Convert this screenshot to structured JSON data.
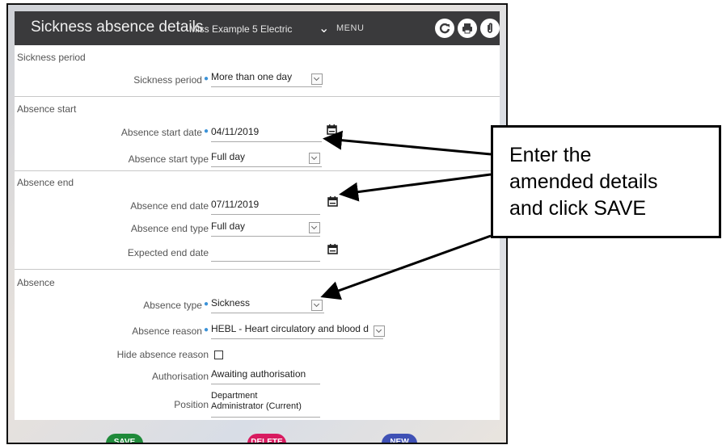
{
  "header": {
    "title": "Sickness absence details",
    "subtitle": "Miss Example 5 Electric",
    "menu_label": "MENU"
  },
  "sections": {
    "sickness_period": {
      "heading": "Sickness period",
      "period_label": "Sickness period",
      "period_value": "More than one day"
    },
    "absence_start": {
      "heading": "Absence start",
      "date_label": "Absence start date",
      "date_value": "04/11/2019",
      "type_label": "Absence start type",
      "type_value": "Full day"
    },
    "absence_end": {
      "heading": "Absence end",
      "date_label": "Absence end date",
      "date_value": "07/11/2019",
      "type_label": "Absence end type",
      "type_value": "Full day",
      "expected_label": "Expected end date",
      "expected_value": ""
    },
    "absence": {
      "heading": "Absence",
      "type_label": "Absence type",
      "type_value": "Sickness",
      "reason_label": "Absence reason",
      "reason_value": "HEBL - Heart circulatory and blood d",
      "hide_label": "Hide absence reason",
      "auth_label": "Authorisation",
      "auth_value": "Awaiting authorisation",
      "position_label": "Position",
      "position_line1": "Department",
      "position_line2": "Administrator (Current)"
    }
  },
  "buttons": {
    "save": "SAVE",
    "delete": "DELETE",
    "new": "NEW"
  },
  "callout": {
    "text": "Enter the\namended details\nand click SAVE"
  },
  "colors": {
    "titlebar": "#3a3a3c",
    "required_dot": "#3c93d8",
    "save": "#1f8a3a",
    "delete": "#d81b60",
    "new": "#3f51b5"
  }
}
